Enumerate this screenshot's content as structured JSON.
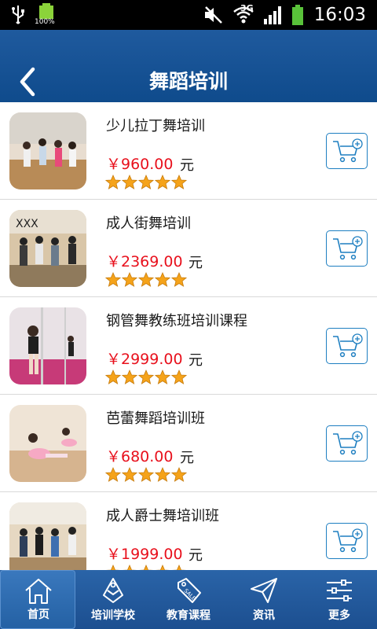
{
  "status_bar": {
    "battery_percent": "100%",
    "network_type": "3G",
    "time": "16:03"
  },
  "header": {
    "title": "舞蹈培训",
    "back_icon": "chevron-left-icon"
  },
  "courses": [
    {
      "name": "少儿拉丁舞培训",
      "price": "￥960.00",
      "unit": "元",
      "rating": 5
    },
    {
      "name": "成人街舞培训",
      "price": "￥2369.00",
      "unit": "元",
      "rating": 5
    },
    {
      "name": "钢管舞教练班培训课程",
      "price": "￥2999.00",
      "unit": "元",
      "rating": 5
    },
    {
      "name": "芭蕾舞蹈培训班",
      "price": "￥680.00",
      "unit": "元",
      "rating": 5
    },
    {
      "name": "成人爵士舞培训班",
      "price": "￥1999.00",
      "unit": "元",
      "rating": 5
    }
  ],
  "bottom_nav": {
    "items": [
      {
        "label": "首页",
        "icon": "home-icon",
        "active": true
      },
      {
        "label": "培训学校",
        "icon": "school-icon",
        "active": false
      },
      {
        "label": "教育课程",
        "icon": "sale-tag-icon",
        "active": false
      },
      {
        "label": "资讯",
        "icon": "paper-plane-icon",
        "active": false
      },
      {
        "label": "更多",
        "icon": "sliders-icon",
        "active": false
      }
    ]
  },
  "colors": {
    "header_blue": "#0f4b8c",
    "price_red": "#e8101c",
    "star_orange": "#f5a31a",
    "cart_blue": "#1e7fc1"
  }
}
